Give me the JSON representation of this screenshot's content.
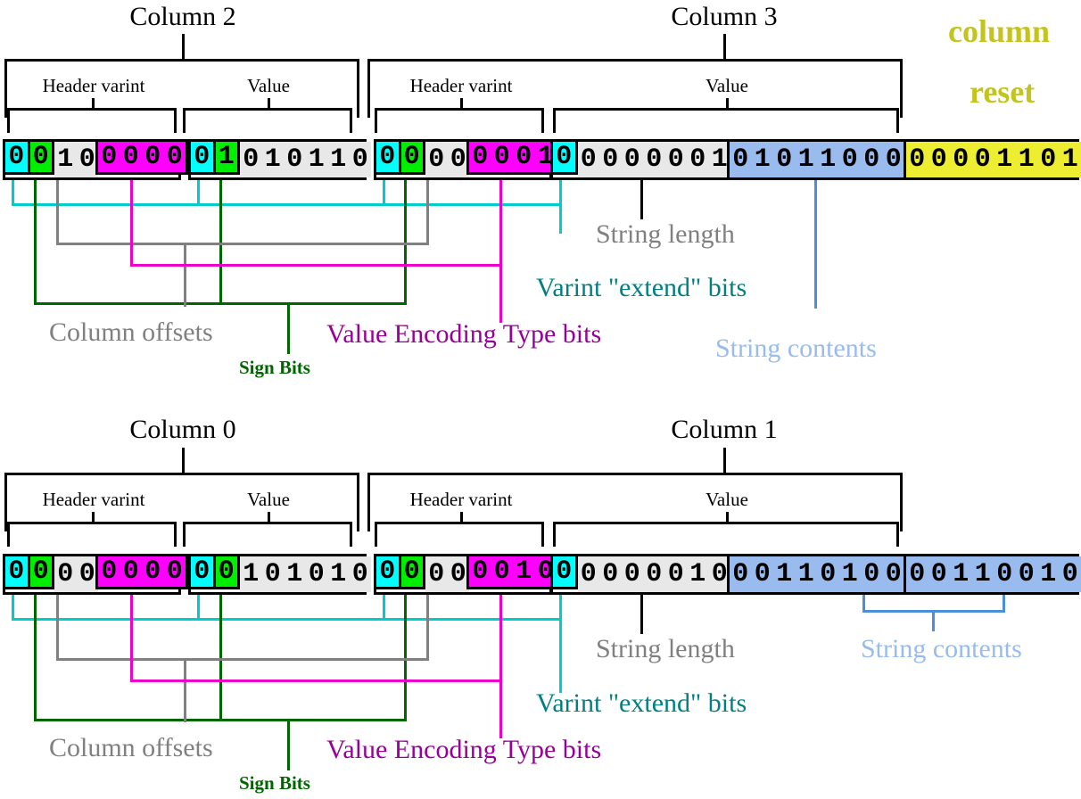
{
  "diagram": {
    "title_note": "column reset",
    "rows": [
      {
        "id": "row-top",
        "columns": [
          {
            "name": "Column 2",
            "parts": [
              "Header varint",
              "Value"
            ]
          },
          {
            "name": "Column 3",
            "parts": [
              "Header varint",
              "Value"
            ]
          }
        ],
        "bytes": [
          {
            "id": "b0",
            "groups": [
              {
                "color": "cyan",
                "bits": "0"
              },
              {
                "color": "green",
                "bits": "0"
              },
              {
                "color": "gray",
                "bits": "10"
              },
              {
                "color": "magenta",
                "bits": "0000"
              }
            ]
          },
          {
            "id": "b1",
            "groups": [
              {
                "color": "cyan",
                "bits": "0"
              },
              {
                "color": "green",
                "bits": "1"
              },
              {
                "color": "gray",
                "bits": "010110"
              }
            ]
          },
          {
            "id": "b2",
            "groups": [
              {
                "color": "cyan",
                "bits": "0"
              },
              {
                "color": "green",
                "bits": "0"
              },
              {
                "color": "gray",
                "bits": "00"
              },
              {
                "color": "magenta",
                "bits": "0001"
              }
            ]
          },
          {
            "id": "b3",
            "groups": [
              {
                "color": "cyan",
                "bits": "0"
              },
              {
                "color": "gray",
                "bits": "0000001"
              }
            ]
          },
          {
            "id": "b4",
            "groups": [
              {
                "color": "blue",
                "bits": "01011000"
              }
            ]
          },
          {
            "id": "b5",
            "groups": [
              {
                "color": "yellow",
                "bits": "00001101"
              }
            ]
          }
        ],
        "callouts": {
          "column_offsets": "Column offsets",
          "sign_bits": "Sign Bits",
          "value_encoding": "Value Encoding Type bits",
          "string_length": "String length",
          "varint_extend": "Varint \"extend\" bits",
          "string_contents": "String contents"
        }
      },
      {
        "id": "row-bottom",
        "columns": [
          {
            "name": "Column 0",
            "parts": [
              "Header varint",
              "Value"
            ]
          },
          {
            "name": "Column 1",
            "parts": [
              "Header varint",
              "Value"
            ]
          }
        ],
        "bytes": [
          {
            "id": "b0",
            "groups": [
              {
                "color": "cyan",
                "bits": "0"
              },
              {
                "color": "green",
                "bits": "0"
              },
              {
                "color": "gray",
                "bits": "00"
              },
              {
                "color": "magenta",
                "bits": "0000"
              }
            ]
          },
          {
            "id": "b1",
            "groups": [
              {
                "color": "cyan",
                "bits": "0"
              },
              {
                "color": "green",
                "bits": "0"
              },
              {
                "color": "gray",
                "bits": "101010"
              }
            ]
          },
          {
            "id": "b2",
            "groups": [
              {
                "color": "cyan",
                "bits": "0"
              },
              {
                "color": "green",
                "bits": "0"
              },
              {
                "color": "gray",
                "bits": "00"
              },
              {
                "color": "magenta",
                "bits": "0010"
              }
            ]
          },
          {
            "id": "b3",
            "groups": [
              {
                "color": "cyan",
                "bits": "0"
              },
              {
                "color": "gray",
                "bits": "0000010"
              }
            ]
          },
          {
            "id": "b4",
            "groups": [
              {
                "color": "blue",
                "bits": "00110100"
              }
            ]
          },
          {
            "id": "b5",
            "groups": [
              {
                "color": "blue",
                "bits": "00110010"
              }
            ]
          }
        ],
        "callouts": {
          "column_offsets": "Column offsets",
          "sign_bits": "Sign Bits",
          "value_encoding": "Value Encoding Type bits",
          "string_length": "String length",
          "varint_extend": "Varint \"extend\" bits",
          "string_contents": "String contents"
        }
      }
    ],
    "colors": {
      "cyan": "#00ffff",
      "green": "#00ee00",
      "gray": "#e8e8e8",
      "magenta": "#ff00ff",
      "blue": "#99bbee",
      "yellow": "#eded31",
      "label_gray": "#808080",
      "label_green": "#006600",
      "label_magenta": "#990099",
      "label_teal": "#008080",
      "label_blue": "#99bbee",
      "label_olive": "#c4c41e"
    }
  }
}
